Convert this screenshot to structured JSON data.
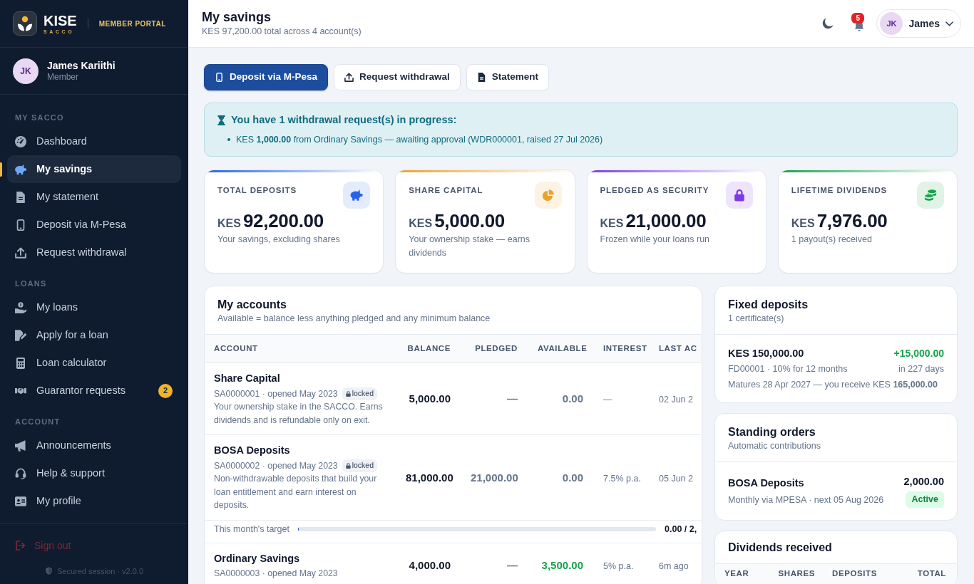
{
  "sidebar": {
    "brand": {
      "name": "KISE",
      "tagline": "SACCO",
      "portal": "MEMBER PORTAL"
    },
    "user": {
      "initials": "JK",
      "name": "James Kariithi",
      "role": "Member"
    },
    "sections": [
      {
        "label": "MY SACCO",
        "items": [
          {
            "label": "Dashboard",
            "selected": false
          },
          {
            "label": "My savings",
            "selected": true
          },
          {
            "label": "My statement",
            "selected": false
          },
          {
            "label": "Deposit via M-Pesa",
            "selected": false
          },
          {
            "label": "Request withdrawal",
            "selected": false
          }
        ]
      },
      {
        "label": "LOANS",
        "items": [
          {
            "label": "My loans",
            "selected": false
          },
          {
            "label": "Apply for a loan",
            "selected": false
          },
          {
            "label": "Loan calculator",
            "selected": false
          },
          {
            "label": "Guarantor requests",
            "selected": false,
            "badge": "2"
          }
        ]
      },
      {
        "label": "ACCOUNT",
        "items": [
          {
            "label": "Announcements",
            "selected": false
          },
          {
            "label": "Help & support",
            "selected": false
          },
          {
            "label": "My profile",
            "selected": false
          }
        ]
      }
    ],
    "sign_out": "Sign out",
    "footer": "Secured session · v2.0.0"
  },
  "header": {
    "title": "My savings",
    "subtitle": "KES 97,200.00 total across 4 account(s)",
    "notification_count": "5",
    "user": {
      "initials": "JK",
      "name": "James"
    }
  },
  "actions": [
    {
      "label": "Deposit via M-Pesa",
      "primary": true
    },
    {
      "label": "Request withdrawal",
      "primary": false
    },
    {
      "label": "Statement",
      "primary": false
    }
  ],
  "alert": {
    "title": "You have 1 withdrawal request(s) in progress:",
    "items": [
      "KES **1,000.00** from Ordinary Savings — awaiting approval (WDR000001, raised 27 Jul 2026)"
    ]
  },
  "stats": [
    {
      "label": "TOTAL DEPOSITS",
      "currency": "KES",
      "value": "92,200.00",
      "note": "Your savings, excluding shares",
      "color": "#2563eb"
    },
    {
      "label": "SHARE CAPITAL",
      "currency": "KES",
      "value": "5,000.00",
      "note": "Your ownership stake — earns dividends",
      "color": "#eaa22f"
    },
    {
      "label": "PLEDGED AS SECURITY",
      "currency": "KES",
      "value": "21,000.00",
      "note": "Frozen while your loans run",
      "color": "#7c3aed"
    },
    {
      "label": "LIFETIME DIVIDENDS",
      "currency": "KES",
      "value": "7,976.00",
      "note": "1 payout(s) received",
      "color": "#16a34a"
    }
  ],
  "accounts": {
    "title": "My accounts",
    "subtitle": "Available = balance less anything pledged and any minimum balance",
    "columns": [
      "ACCOUNT",
      "BALANCE",
      "PLEDGED",
      "AVAILABLE",
      "INTEREST",
      "LAST AC"
    ],
    "rows": [
      {
        "name": "Share Capital",
        "meta": "SA0000001 · opened May 2023",
        "locked": true,
        "lock_label": "locked",
        "description": "Your ownership stake in the SACCO. Earns dividends and is refundable only on exit.",
        "balance": "5,000.00",
        "pledged": "—",
        "available": "0.00",
        "available_highlighted": false,
        "interest": "—",
        "last_activity": "02 Jun 2"
      },
      {
        "name": "BOSA Deposits",
        "meta": "SA0000002 · opened May 2023",
        "locked": true,
        "lock_label": "locked",
        "description": "Non-withdrawable deposits that build your loan entitlement and earn interest on deposits.",
        "balance": "81,000.00",
        "pledged": "21,000.00",
        "available": "0.00",
        "available_highlighted": false,
        "interest": "7.5% p.a.",
        "last_activity": "05 Jun 2",
        "target": {
          "label": "This month's target",
          "level": 0,
          "reading": "0.00 / 2,"
        }
      },
      {
        "name": "Ordinary Savings",
        "meta": "SA0000003 · opened May 2023",
        "locked": false,
        "balance": "4,000.00",
        "pledged": "—",
        "available": "3,500.00",
        "available_highlighted": true,
        "interest": "5% p.a.",
        "last_activity": "6m ago"
      }
    ]
  },
  "fixed_deposits": {
    "title": "Fixed deposits",
    "subtitle": "1 certificate(s)",
    "items": [
      {
        "amount": "KES 150,000.00",
        "gain": "+15,000.00",
        "details": "FD00001 · 10% for 12 months",
        "remaining": "in 227 days",
        "maturity": "Matures 28 Apr 2027 — you receive KES **165,000.00**"
      }
    ]
  },
  "standing_orders": {
    "title": "Standing orders",
    "subtitle": "Automatic contributions",
    "items": [
      {
        "account": "BOSA Deposits",
        "amount": "2,000.00",
        "schedule": "Monthly via MPESA · next 05 Aug 2026",
        "status": "Active",
        "active": true
      }
    ]
  },
  "dividends": {
    "title": "Dividends received",
    "columns": [
      "YEAR",
      "SHARES",
      "DEPOSITS",
      "TOTAL"
    ]
  }
}
